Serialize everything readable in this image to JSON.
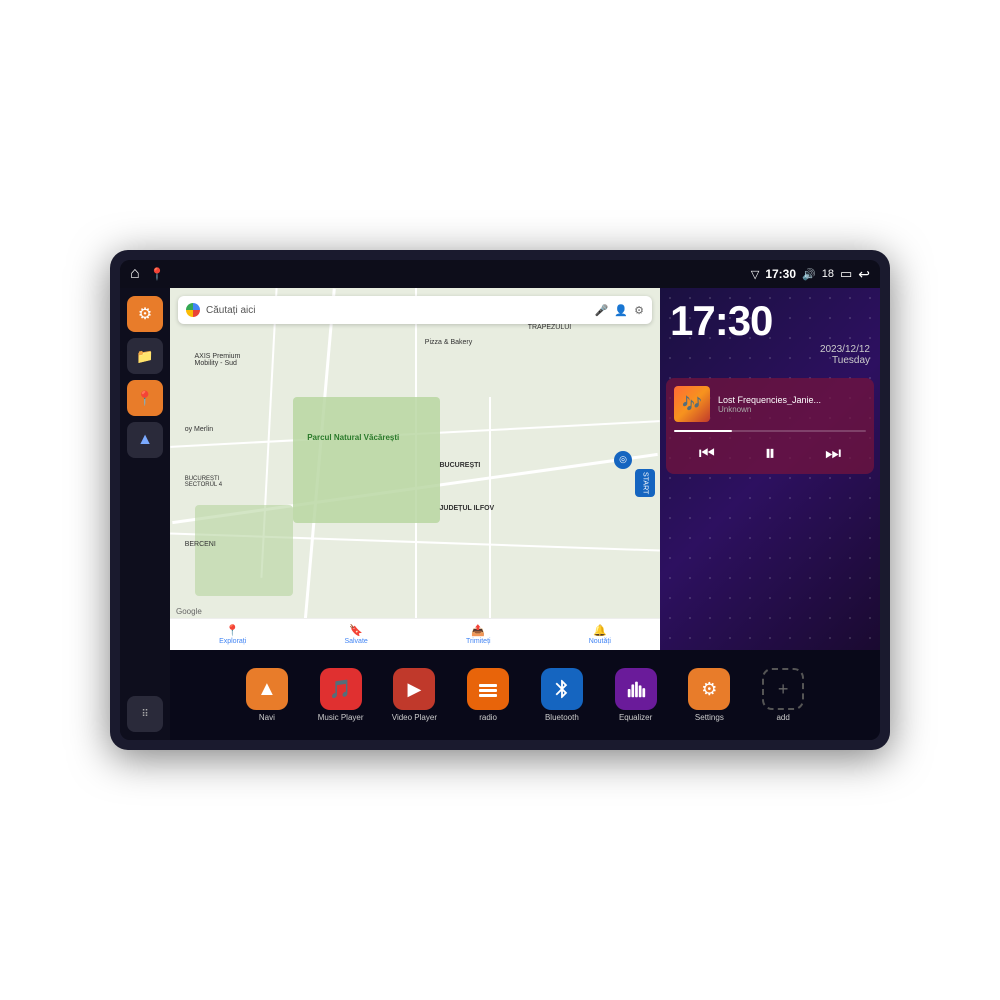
{
  "device": {
    "status_bar": {
      "home_icon": "⌂",
      "map_icon": "📍",
      "wifi_icon": "▽",
      "time": "17:30",
      "volume_icon": "🔊",
      "battery_level": "18",
      "battery_icon": "▭",
      "back_icon": "↩"
    },
    "clock": {
      "time": "17:30",
      "date": "2023/12/12",
      "day": "Tuesday"
    },
    "music": {
      "title": "Lost Frequencies_Janie...",
      "artist": "Unknown",
      "album_emoji": "🎵"
    },
    "map": {
      "search_placeholder": "Căutați aici",
      "labels": [
        "AXIS Premium Mobility - Sud",
        "Pizza & Bakery",
        "TRAPEZULUI",
        "Parcul Natural Văcărești",
        "oy Merlin",
        "BUCUREȘTI SECTORUL 4",
        "BUCUREȘTI",
        "JUDEȚUL ILFOV",
        "BERCENI"
      ],
      "bottom_items": [
        {
          "icon": "📍",
          "label": "Explorați"
        },
        {
          "icon": "🔖",
          "label": "Salvate"
        },
        {
          "icon": "📤",
          "label": "Trimiteți"
        },
        {
          "icon": "🔔",
          "label": "Noutăți"
        }
      ]
    },
    "sidebar": {
      "items": [
        {
          "icon": "⚙",
          "color": "orange",
          "label": "settings"
        },
        {
          "icon": "📁",
          "color": "dark",
          "label": "files"
        },
        {
          "icon": "📍",
          "color": "orange",
          "label": "map"
        },
        {
          "icon": "▲",
          "color": "dark",
          "label": "navigation"
        },
        {
          "icon": "⋮⋮⋮",
          "color": "dark",
          "label": "apps"
        }
      ]
    },
    "apps": [
      {
        "icon": "▲",
        "color": "orange",
        "label": "Navi",
        "icon_type": "navi"
      },
      {
        "icon": "🎵",
        "color": "red",
        "label": "Music Player"
      },
      {
        "icon": "▶",
        "color": "dark-red",
        "label": "Video Player"
      },
      {
        "icon": "📻",
        "color": "orange2",
        "label": "radio"
      },
      {
        "icon": "✦",
        "color": "blue",
        "label": "Bluetooth"
      },
      {
        "icon": "⚖",
        "color": "purple",
        "label": "Equalizer"
      },
      {
        "icon": "⚙",
        "color": "gear-orange",
        "label": "Settings"
      },
      {
        "icon": "+",
        "color": "grid-outline",
        "label": "add"
      }
    ]
  }
}
